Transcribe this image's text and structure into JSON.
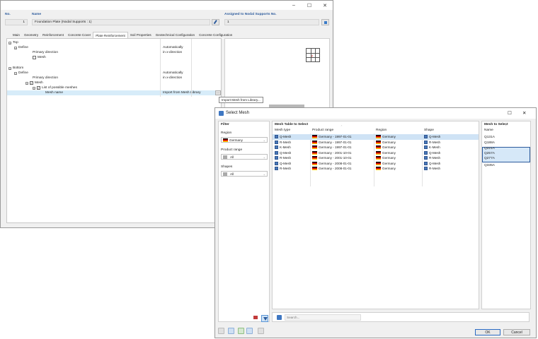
{
  "main": {
    "window_controls": [
      "–",
      "☐",
      "✕"
    ],
    "no_label": "No.",
    "no_value": "1",
    "name_label": "Name",
    "name_value": "Foundation Plate (Nodal Supports : 1)",
    "assigned_label": "Assigned to Nodal Supports No.",
    "assigned_value": "1",
    "tabs": [
      "Main",
      "Geometry",
      "Reinforcement",
      "Concrete Cover",
      "Plate Reinforcement",
      "Soil Properties",
      "Geotechnical Configuration",
      "Concrete Configuration"
    ],
    "active_tab": "Plate Reinforcement",
    "tree": {
      "top_label": "Top",
      "define_label": "Define",
      "define_value": "Automatically",
      "primary_direction_label": "Primary direction",
      "primary_direction_value": "in x-direction",
      "mesh_label": "Mesh",
      "bottom_label": "Bottom",
      "define2_value": "Automatically",
      "primary2_value": "in x-direction",
      "mesh2_label": "Mesh",
      "list_label": "List of possible meshes",
      "mesh_name_label": "Mesh name",
      "mesh_name_value": "Import from Mesh Library",
      "mesh_name_btn": "..."
    },
    "tooltip": "Import Mesh from Library..."
  },
  "dialog": {
    "title": "Select Mesh",
    "window_controls": [
      "☐",
      "✕"
    ],
    "filter_title": "Filter",
    "region_label": "Region",
    "region_value": "Germany",
    "product_range_label": "Product range",
    "product_range_value": "All",
    "shapes_label": "Shapes",
    "shapes_value": "All",
    "table_title": "Mesh Table to Select",
    "columns": [
      "Mesh type",
      "Product range",
      "Region",
      "Shape"
    ],
    "rows": [
      [
        "Q-Mesh",
        "Germany - 1997-01-01",
        "Germany",
        "Q-Mesh"
      ],
      [
        "R-Mesh",
        "Germany - 1997-01-01",
        "Germany",
        "R-Mesh"
      ],
      [
        "K-Mesh",
        "Germany - 1997-01-01",
        "Germany",
        "K-Mesh"
      ],
      [
        "Q-Mesh",
        "Germany - 2001-10-01",
        "Germany",
        "Q-Mesh"
      ],
      [
        "R-Mesh",
        "Germany - 2001-10-01",
        "Germany",
        "R-Mesh"
      ],
      [
        "Q-Mesh",
        "Germany - 2008-01-01",
        "Germany",
        "Q-Mesh"
      ],
      [
        "R-Mesh",
        "Germany - 2008-01-01",
        "Germany",
        "R-Mesh"
      ]
    ],
    "selected_row": 0,
    "select_title": "Mesh to Select",
    "select_col": "Name",
    "names": [
      "Q131A",
      "Q188A",
      "Q221A",
      "Q257A",
      "Q277A",
      "Q335A"
    ],
    "selected_names": [
      2,
      3,
      4
    ],
    "search_placeholder": "Search...",
    "ok_label": "OK",
    "cancel_label": "Cancel"
  },
  "colors": {
    "header_blue": "#2b5a9c",
    "selection": "#cfe3f5",
    "accent": "#2a6bc4"
  }
}
